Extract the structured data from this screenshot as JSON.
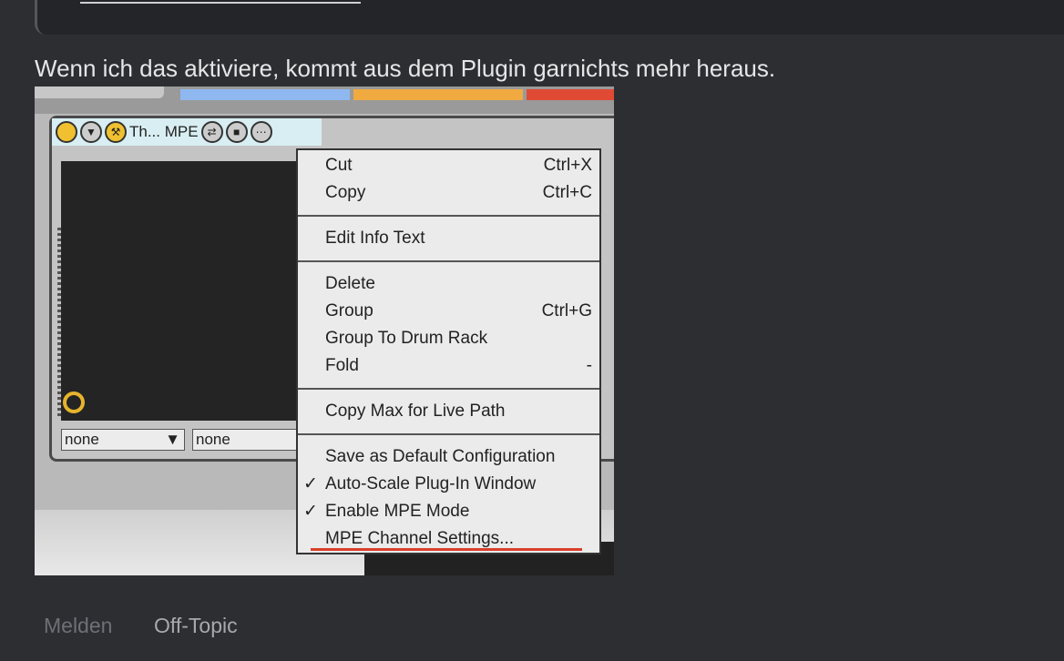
{
  "post": {
    "text": "Wenn ich das aktiviere, kommt aus dem Plugin garnichts mehr heraus."
  },
  "screenshot": {
    "device_title": "Th... MPE",
    "selectors": [
      "none",
      "none"
    ],
    "track_colors": [
      "#8fb8f0",
      "#f0aa40",
      "#e04a35"
    ],
    "menu": {
      "groups": [
        [
          {
            "label": "Cut",
            "shortcut": "Ctrl+X"
          },
          {
            "label": "Copy",
            "shortcut": "Ctrl+C"
          }
        ],
        [
          {
            "label": "Edit Info Text"
          }
        ],
        [
          {
            "label": "Delete"
          },
          {
            "label": "Group",
            "shortcut": "Ctrl+G"
          },
          {
            "label": "Group To Drum Rack"
          },
          {
            "label": "Fold",
            "shortcut": "-"
          }
        ],
        [
          {
            "label": "Copy Max for Live Path"
          }
        ],
        [
          {
            "label": "Save as Default Configuration"
          },
          {
            "label": "Auto-Scale Plug-In Window",
            "checked": true
          },
          {
            "label": "Enable MPE Mode",
            "checked": true
          },
          {
            "label": "MPE Channel Settings..."
          }
        ]
      ],
      "check": "✓"
    }
  },
  "footer": {
    "report": "Melden",
    "offtopic": "Off-Topic"
  }
}
